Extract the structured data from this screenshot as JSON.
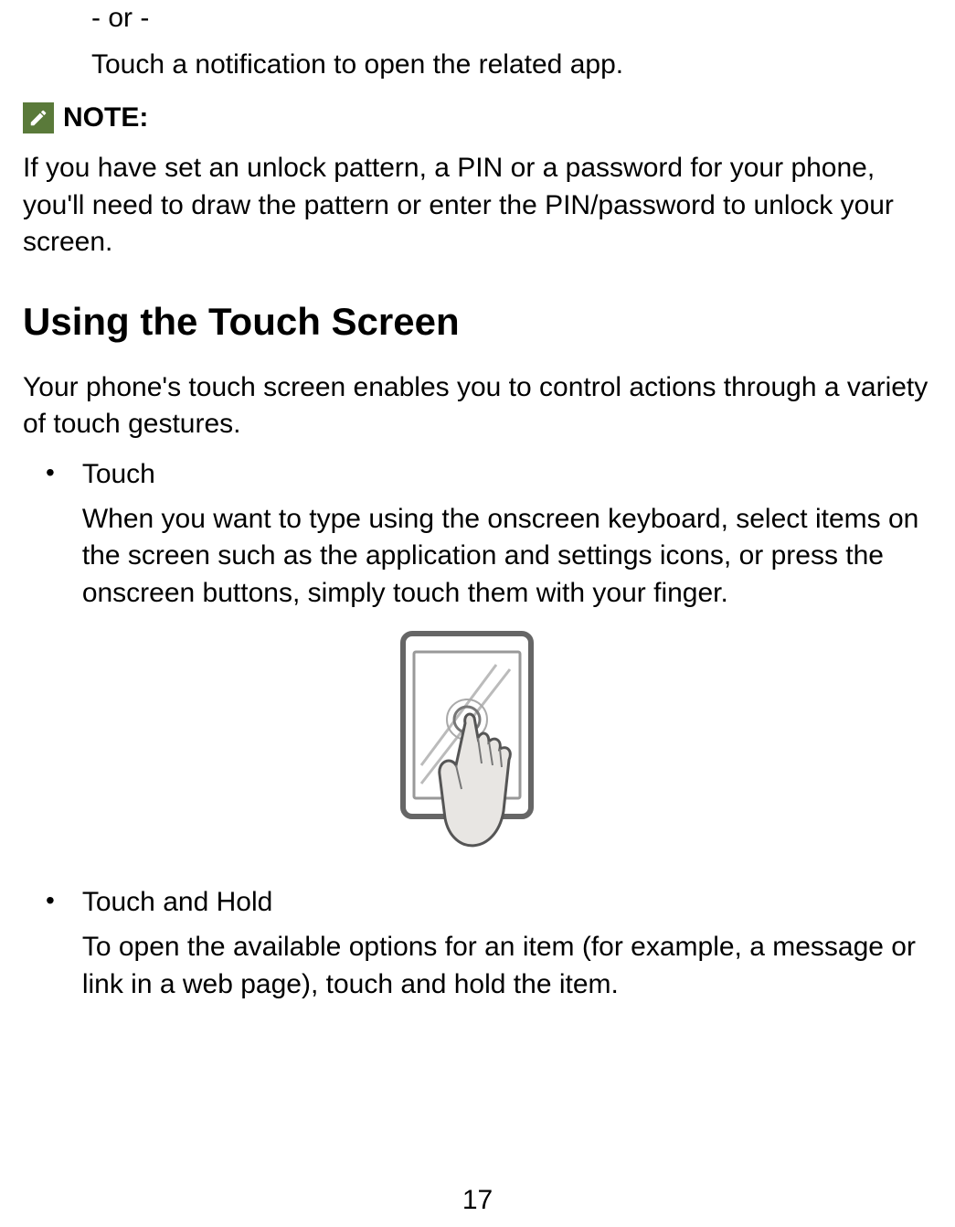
{
  "indent1": "- or -",
  "indent2": "Touch a notification to open the related app.",
  "note": {
    "label": "NOTE:",
    "body": "If you have set an unlock pattern, a PIN or a password for your phone, you'll need to draw the pattern or enter the PIN/password to unlock your screen."
  },
  "heading": "Using the Touch Screen",
  "intro": "Your phone's touch screen enables you to control actions through a variety of touch gestures.",
  "bullets": [
    {
      "title": "Touch",
      "desc": "When you want to type using the onscreen keyboard, select items on the screen such as the application and settings icons, or press the onscreen buttons, simply touch them with your finger."
    },
    {
      "title": "Touch and Hold",
      "desc": "To open the available options for an item (for example, a message or link in a web page), touch and hold the item."
    }
  ],
  "pageNumber": "17"
}
